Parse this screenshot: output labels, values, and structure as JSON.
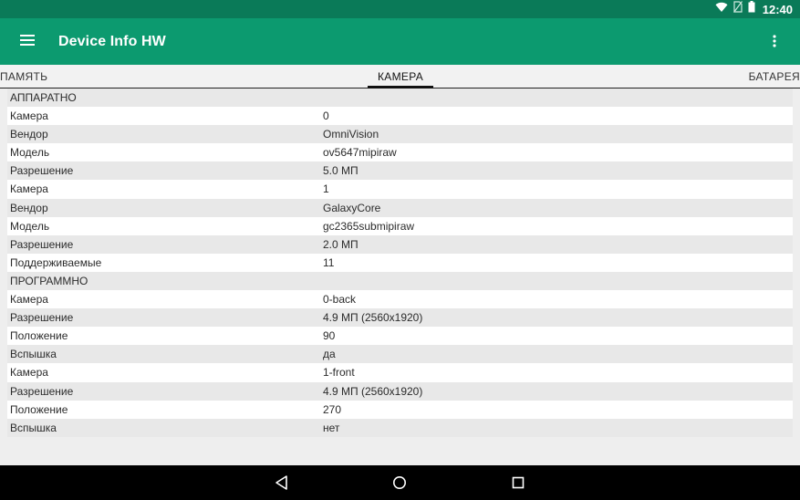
{
  "status_bar": {
    "time": "12:40",
    "icons": [
      "wifi-icon",
      "no-sim-icon",
      "battery-icon"
    ]
  },
  "app_bar": {
    "title": "Device Info HW",
    "menu_icon": "hamburger-menu-icon",
    "overflow_icon": "more-vert-icon"
  },
  "tabs": {
    "left": "ПАМЯТЬ",
    "active": "КАМЕРА",
    "right": "БАТАРЕЯ"
  },
  "sections": [
    {
      "title": "АППАРАТНО",
      "rows": [
        {
          "key": "Камера",
          "value": "0"
        },
        {
          "key": "Вендор",
          "value": "OmniVision"
        },
        {
          "key": "Модель",
          "value": "ov5647mipiraw"
        },
        {
          "key": "Разрешение",
          "value": "5.0 МП"
        },
        {
          "key": "Камера",
          "value": "1"
        },
        {
          "key": "Вендор",
          "value": "GalaxyCore"
        },
        {
          "key": "Модель",
          "value": "gc2365submipiraw"
        },
        {
          "key": "Разрешение",
          "value": "2.0 МП"
        },
        {
          "key": "Поддерживаемые",
          "value": "11"
        }
      ]
    },
    {
      "title": "ПРОГРАММНО",
      "rows": [
        {
          "key": "Камера",
          "value": "0-back"
        },
        {
          "key": "Разрешение",
          "value": "4.9 МП (2560x1920)"
        },
        {
          "key": "Положение",
          "value": "90"
        },
        {
          "key": "Вспышка",
          "value": "да"
        },
        {
          "key": "Камера",
          "value": "1-front"
        },
        {
          "key": "Разрешение",
          "value": "4.9 МП (2560x1920)"
        },
        {
          "key": "Положение",
          "value": "270"
        },
        {
          "key": "Вспышка",
          "value": "нет"
        }
      ]
    }
  ],
  "nav_bar": {
    "icons": [
      "back-icon",
      "home-icon",
      "recents-icon"
    ]
  },
  "colors": {
    "status_bar": "#0a7a58",
    "app_bar": "#0c9a6f",
    "row_light": "#ffffff",
    "row_dark": "#e8e8e8"
  }
}
